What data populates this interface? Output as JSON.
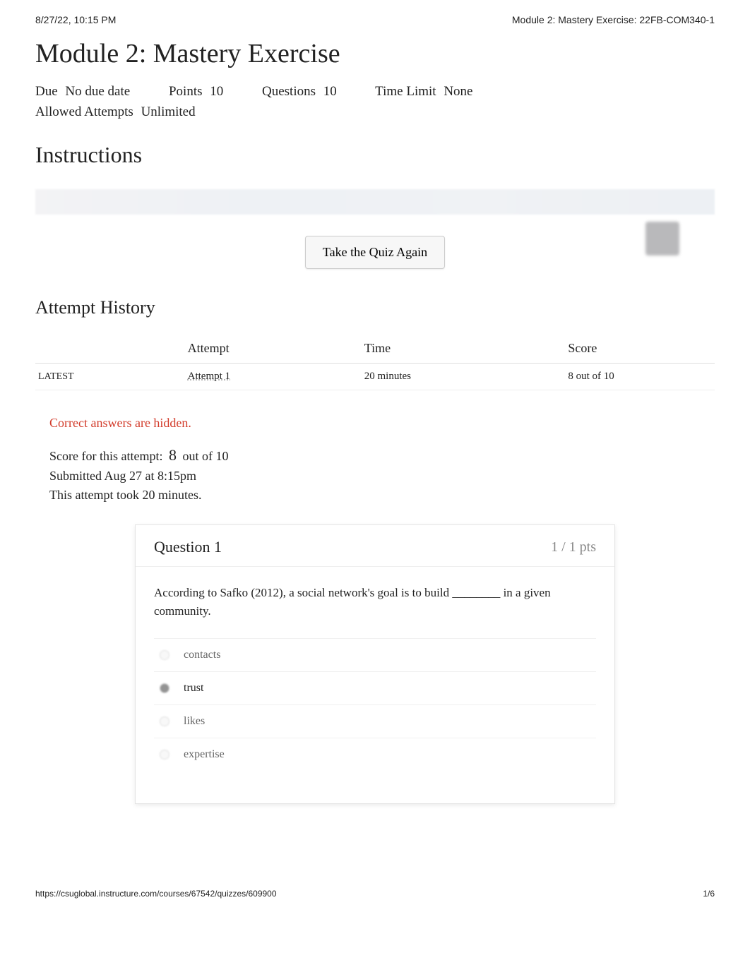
{
  "header": {
    "timestamp": "8/27/22, 10:15 PM",
    "doc_title": "Module 2: Mastery Exercise: 22FB-COM340-1"
  },
  "title": "Module 2: Mastery Exercise",
  "meta": {
    "due_label": "Due",
    "due_value": "No due date",
    "points_label": "Points",
    "points_value": "10",
    "questions_label": "Questions",
    "questions_value": "10",
    "time_limit_label": "Time Limit",
    "time_limit_value": "None",
    "allowed_attempts_label": "Allowed Attempts",
    "allowed_attempts_value": "Unlimited"
  },
  "instructions_title": "Instructions",
  "take_again_label": "Take the Quiz Again",
  "attempt_history": {
    "title": "Attempt History",
    "columns": {
      "blank": "",
      "attempt": "Attempt",
      "time": "Time",
      "score": "Score"
    },
    "rows": [
      {
        "status": "LATEST",
        "attempt": "Attempt 1",
        "time": "20 minutes",
        "score": "8 out of 10"
      }
    ]
  },
  "notice": "Correct answers are hidden.",
  "score_info": {
    "line1_a": "Score for this attempt:",
    "line1_score": "8",
    "line1_b": "out of 10",
    "line2": "Submitted Aug 27 at 8:15pm",
    "line3": "This attempt took 20 minutes."
  },
  "question": {
    "title": "Question 1",
    "pts": "1 / 1 pts",
    "text": "According to Safko (2012), a social network's goal is to build ________ in a given community.",
    "answers": [
      {
        "label": "contacts",
        "selected": false
      },
      {
        "label": "trust",
        "selected": true
      },
      {
        "label": "likes",
        "selected": false
      },
      {
        "label": "expertise",
        "selected": false
      }
    ]
  },
  "footer": {
    "url": "https://csuglobal.instructure.com/courses/67542/quizzes/609900",
    "page": "1/6"
  }
}
